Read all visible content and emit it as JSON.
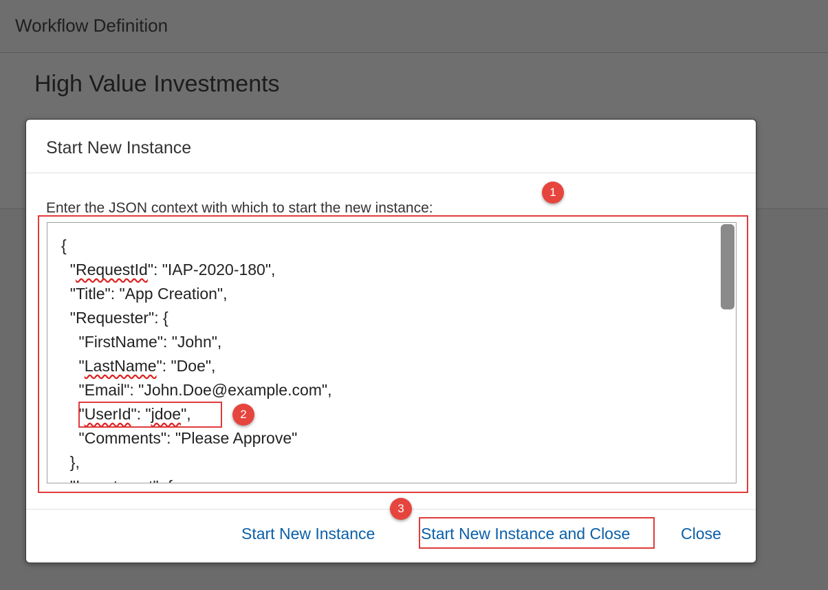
{
  "topbar": {
    "title": "Workflow Definition"
  },
  "page": {
    "title": "High Value Investments"
  },
  "dialog": {
    "title": "Start New Instance",
    "prompt": "Enter the JSON context with which to start the new instance:",
    "json_lines": [
      "{",
      "  \"RequestId\": \"IAP-2020-180\",",
      "  \"Title\": \"App Creation\",",
      "  \"Requester\": {",
      "    \"FirstName\": \"John\",",
      "    \"LastName\": \"Doe\",",
      "    \"Email\": \"John.Doe@example.com\",",
      "    \"UserId\": \"jdoe\",",
      "    \"Comments\": \"Please Approve\"",
      "  },",
      "  \"Investment\": {"
    ],
    "buttons": {
      "start": "Start New Instance",
      "start_close": "Start New Instance and Close",
      "close": "Close"
    }
  },
  "annotations": {
    "badge1": "1",
    "badge2": "2",
    "badge3": "3"
  },
  "colors": {
    "annotation": "#e03a3a",
    "link": "#0a5fa8",
    "overlay": "#6b6b6b"
  }
}
